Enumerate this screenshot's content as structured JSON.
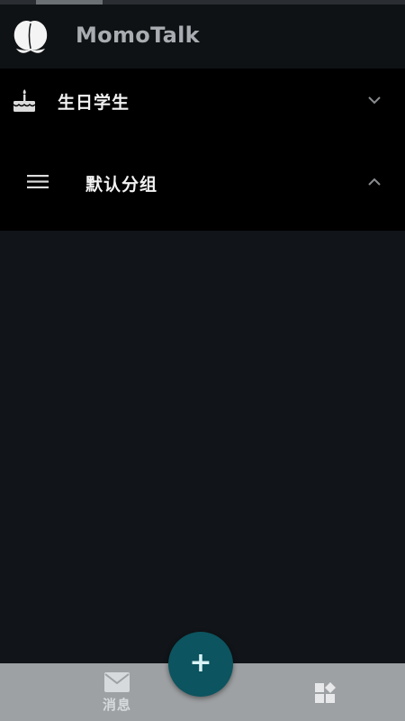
{
  "header": {
    "title": "MomoTalk",
    "logo_icon": "peach-icon"
  },
  "groups": [
    {
      "label": "生日学生",
      "icon": "cake-icon",
      "expanded": false
    },
    {
      "label": "默认分组",
      "icon": "menu-icon",
      "expanded": true
    }
  ],
  "fab": {
    "label": "+"
  },
  "bottom_nav": {
    "messages_label": "消息",
    "messages_icon": "mail-icon",
    "apps_icon": "widgets-icon"
  },
  "colors": {
    "background": "#111418",
    "header_bg": "#0f1214",
    "list_bg": "#000000",
    "nav_bg": "#9ea1a3",
    "fab_bg": "#0c545f",
    "title_color": "#a9adb1"
  }
}
